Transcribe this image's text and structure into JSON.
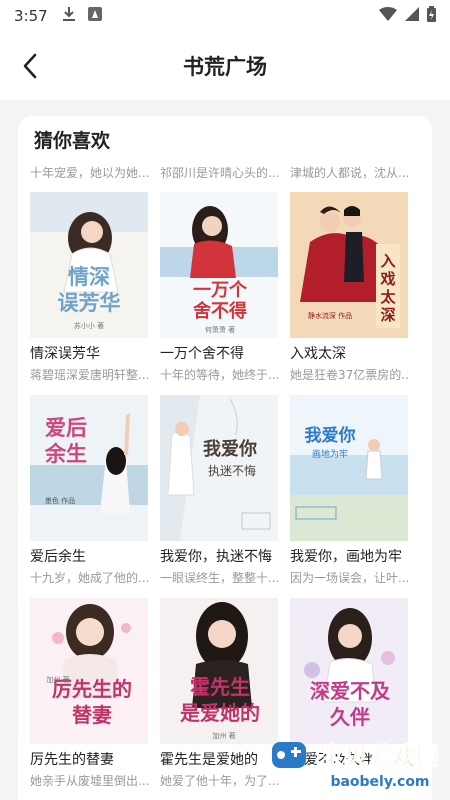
{
  "status": {
    "time": "3:57"
  },
  "nav": {
    "title": "书荒广场"
  },
  "section": {
    "title": "猜你喜欢"
  },
  "top_descs": [
    "十年宠爱，她以为她...",
    "祁邵川是许晴心头的...",
    "津城的人都说，沈从..."
  ],
  "books": [
    {
      "title": "情深误芳华",
      "desc": "蒋碧瑶深爱唐明轩整...",
      "cover_text": "情深误芳华",
      "author": "苏小小 著",
      "palette": [
        "#f6f4ee",
        "#6fa3c8"
      ]
    },
    {
      "title": "一万个舍不得",
      "desc": "十年的等待，她终于...",
      "cover_text": "一万个舍不得",
      "author": "何萧萧 著",
      "palette": [
        "#f4f8fb",
        "#d2343b"
      ]
    },
    {
      "title": "入戏太深",
      "desc": "她是狂卷37亿票房的...",
      "cover_text": "入戏太深",
      "author": "静水流深 作品",
      "palette": [
        "#f3d9b8",
        "#b21f2b"
      ]
    },
    {
      "title": "爱后余生",
      "desc": "十九岁，她成了他的...",
      "cover_text": "爱后余生",
      "author": "墨色 作品",
      "palette": [
        "#eef3f7",
        "#d0467a"
      ]
    },
    {
      "title": "我爱你，执迷不悔",
      "desc": "一眼误终生，整整十...",
      "cover_text": "我爱你 执迷不悔",
      "author": "",
      "palette": [
        "#f0f4f6",
        "#7a6a5a"
      ]
    },
    {
      "title": "我爱你，画地为牢",
      "desc": "因为一场误会，让叶...",
      "cover_text": "我爱你 画地为牢",
      "author": "",
      "palette": [
        "#eef5fb",
        "#2b7ac8"
      ]
    },
    {
      "title": "厉先生的替妻",
      "desc": "她亲手从废墟里倒出...",
      "cover_text": "厉先生的替妻",
      "author": "加州 著",
      "palette": [
        "#fbf1f4",
        "#c2336a"
      ]
    },
    {
      "title": "霍先生是爱她的",
      "desc": "她爱了他十年，为了...",
      "cover_text": "霍先生是爱她的",
      "author": "加州 著",
      "palette": [
        "#f6f1f1",
        "#c2336a"
      ]
    },
    {
      "title": "深爱不及久伴",
      "desc": "",
      "cover_text": "深爱不及久伴",
      "author": "",
      "palette": [
        "#f1ecf6",
        "#c23a8a"
      ]
    }
  ],
  "watermark": {
    "text": "宝贝游戏网",
    "url": "baobely.com"
  }
}
